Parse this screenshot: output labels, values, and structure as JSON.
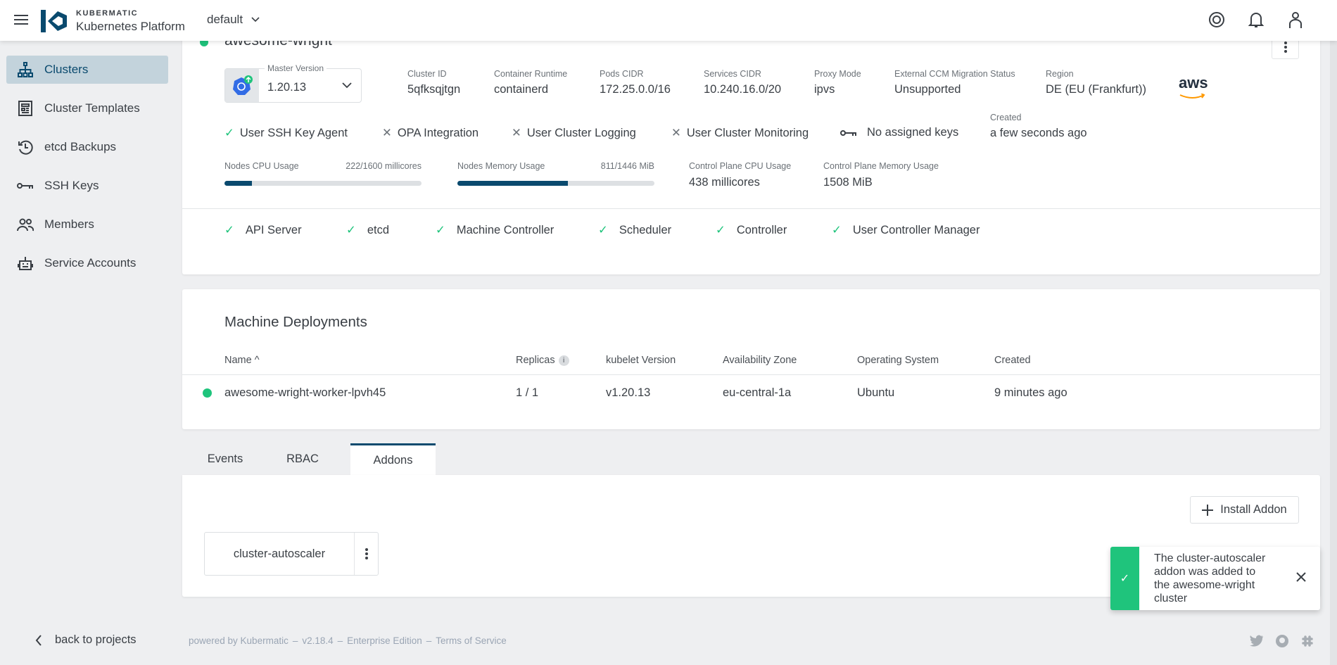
{
  "header": {
    "brand_top": "KUBERMATIC",
    "brand_bottom": "Kubernetes Platform",
    "project": "default"
  },
  "sidebar": {
    "items": [
      {
        "label": "Clusters",
        "icon": "sitemap-icon",
        "active": true
      },
      {
        "label": "Cluster Templates",
        "icon": "template-icon"
      },
      {
        "label": "etcd Backups",
        "icon": "history-icon"
      },
      {
        "label": "SSH Keys",
        "icon": "key-icon"
      },
      {
        "label": "Members",
        "icon": "members-icon"
      },
      {
        "label": "Service Accounts",
        "icon": "robot-icon"
      }
    ],
    "back": "back to projects"
  },
  "cluster": {
    "name": "awesome-wright",
    "master_version_label": "Master Version",
    "master_version": "1.20.13",
    "info": [
      {
        "label": "Cluster ID",
        "value": "5qfksqjtgn"
      },
      {
        "label": "Container Runtime",
        "value": "containerd"
      },
      {
        "label": "Pods CIDR",
        "value": "172.25.0.0/16"
      },
      {
        "label": "Services CIDR",
        "value": "10.240.16.0/20"
      },
      {
        "label": "Proxy Mode",
        "value": "ipvs"
      },
      {
        "label": "External CCM Migration Status",
        "value": "Unsupported"
      },
      {
        "label": "Region",
        "value": "DE (EU (Frankfurt))"
      }
    ],
    "provider": "aws",
    "features": [
      {
        "label": "User SSH Key Agent",
        "enabled": true
      },
      {
        "label": "OPA Integration",
        "enabled": false
      },
      {
        "label": "User Cluster Logging",
        "enabled": false
      },
      {
        "label": "User Cluster Monitoring",
        "enabled": false
      }
    ],
    "ssh_keys": "No assigned keys",
    "created_label": "Created",
    "created": "a few seconds ago",
    "usage": {
      "cpu_label": "Nodes CPU Usage",
      "cpu_value": "222/1600 millicores",
      "cpu_fraction": 0.139,
      "mem_label": "Nodes Memory Usage",
      "mem_value": "811/1446 MiB",
      "mem_fraction": 0.561,
      "cp_cpu_label": "Control Plane CPU Usage",
      "cp_cpu_value": "438 millicores",
      "cp_mem_label": "Control Plane Memory Usage",
      "cp_mem_value": "1508 MiB"
    },
    "health": [
      "API Server",
      "etcd",
      "Machine Controller",
      "Scheduler",
      "Controller",
      "User Controller Manager"
    ]
  },
  "machine_deployments": {
    "title": "Machine Deployments",
    "columns": [
      "Name ^",
      "Replicas",
      "kubelet Version",
      "Availability Zone",
      "Operating System",
      "Created"
    ],
    "rows": [
      {
        "name": "awesome-wright-worker-lpvh45",
        "replicas": "1 / 1",
        "kubelet": "v1.20.13",
        "zone": "eu-central-1a",
        "os": "Ubuntu",
        "created": "9 minutes ago"
      }
    ]
  },
  "tabs": [
    {
      "label": "Events"
    },
    {
      "label": "RBAC"
    },
    {
      "label": "Addons",
      "active": true
    }
  ],
  "addons": {
    "install_label": "Install Addon",
    "items": [
      "cluster-autoscaler"
    ]
  },
  "toast": {
    "message": "The cluster-autoscaler addon was added to the awesome-wright cluster"
  },
  "footer": {
    "powered": "powered by Kubermatic",
    "sep": "–",
    "version": "v2.18.4",
    "edition": "Enterprise Edition",
    "tos": "Terms of Service"
  },
  "colors": {
    "primary": "#0a4a6e",
    "success": "#1fc47c"
  }
}
